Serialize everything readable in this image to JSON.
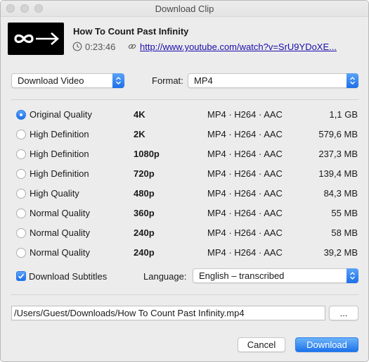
{
  "window": {
    "title": "Download Clip"
  },
  "clip": {
    "title": "How To Count Past Infinity",
    "duration": "0:23:46",
    "url": "http://www.youtube.com/watch?v=SrU9YDoXE..."
  },
  "download_mode": {
    "selected": "Download Video"
  },
  "format": {
    "label": "Format:",
    "selected": "MP4"
  },
  "qualities": [
    {
      "name": "Original Quality",
      "resolution": "4K",
      "codec": "MP4 · H264 · AAC",
      "size": "1,1 GB",
      "selected": true
    },
    {
      "name": "High Definition",
      "resolution": "2K",
      "codec": "MP4 · H264 · AAC",
      "size": "579,6 MB",
      "selected": false
    },
    {
      "name": "High Definition",
      "resolution": "1080p",
      "codec": "MP4 · H264 · AAC",
      "size": "237,3 MB",
      "selected": false
    },
    {
      "name": "High Definition",
      "resolution": "720p",
      "codec": "MP4 · H264 · AAC",
      "size": "139,4 MB",
      "selected": false
    },
    {
      "name": "High Quality",
      "resolution": "480p",
      "codec": "MP4 · H264 · AAC",
      "size": "84,3 MB",
      "selected": false
    },
    {
      "name": "Normal Quality",
      "resolution": "360p",
      "codec": "MP4 · H264 · AAC",
      "size": "55 MB",
      "selected": false
    },
    {
      "name": "Normal Quality",
      "resolution": "240p",
      "codec": "MP4 · H264 · AAC",
      "size": "58 MB",
      "selected": false
    },
    {
      "name": "Normal Quality",
      "resolution": "240p",
      "codec": "MP4 · H264 · AAC",
      "size": "39,2 MB",
      "selected": false
    }
  ],
  "subtitles": {
    "label": "Download Subtitles",
    "checked": true,
    "language_label": "Language:",
    "language": "English – transcribed"
  },
  "save_path": {
    "value": "/Users/Guest/Downloads/How To Count Past Infinity.mp4",
    "browse_label": "..."
  },
  "buttons": {
    "cancel": "Cancel",
    "download": "Download"
  },
  "icons": {
    "thumbnail": "infinity-arrow-logo",
    "duration": "clock-icon",
    "url": "link-icon"
  }
}
